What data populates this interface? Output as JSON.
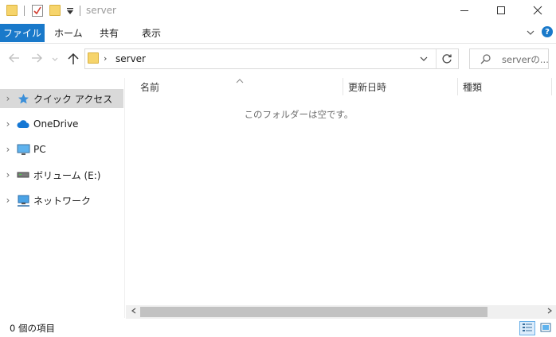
{
  "window": {
    "title": "server",
    "minimize_icon": "minimize-icon",
    "maximize_icon": "maximize-icon",
    "close_icon": "close-icon"
  },
  "ribbon": {
    "tabs": [
      "ファイル",
      "ホーム",
      "共有",
      "表示"
    ],
    "file_tab_color": "#1979ca"
  },
  "address_bar": {
    "path": "server"
  },
  "search": {
    "placeholder": "serverの..."
  },
  "nav_pane": {
    "items": [
      {
        "label": "クイック アクセス",
        "icon": "star-icon",
        "selected": true
      },
      {
        "label": "OneDrive",
        "icon": "cloud-icon",
        "selected": false
      },
      {
        "label": "PC",
        "icon": "monitor-icon",
        "selected": false
      },
      {
        "label": "ボリューム (E:)",
        "icon": "drive-icon",
        "selected": false
      },
      {
        "label": "ネットワーク",
        "icon": "network-icon",
        "selected": false
      }
    ]
  },
  "columns": [
    "名前",
    "更新日時",
    "種類"
  ],
  "content": {
    "empty_message": "このフォルダーは空です。"
  },
  "status": {
    "item_count": "0 個の項目"
  }
}
